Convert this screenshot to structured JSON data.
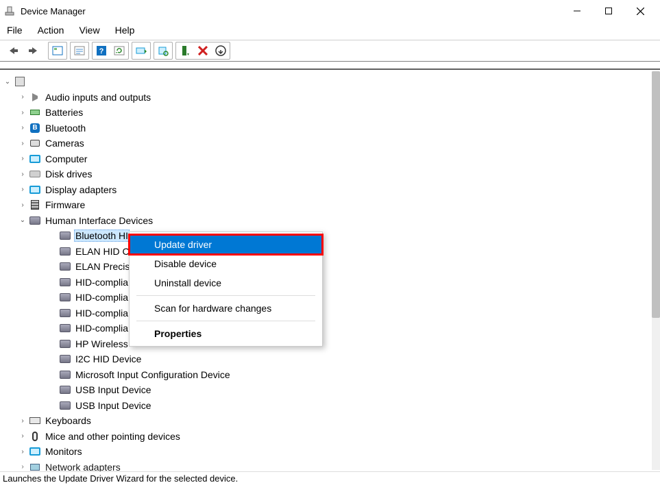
{
  "window": {
    "title": "Device Manager"
  },
  "menubar": [
    "File",
    "Action",
    "View",
    "Help"
  ],
  "toolbar_buttons": [
    "back",
    "forward",
    "sep",
    "show-hidden",
    "sep",
    "properties",
    "sep",
    "help",
    "refresh",
    "sep",
    "update-driver",
    "sep",
    "scan-hardware",
    "sep",
    "enable",
    "disable",
    "uninstall"
  ],
  "root": {
    "expanded": true
  },
  "tree": [
    {
      "icon": "speaker",
      "label": "Audio inputs and outputs",
      "expandable": true
    },
    {
      "icon": "battery",
      "label": "Batteries",
      "expandable": true
    },
    {
      "icon": "bluetooth",
      "label": "Bluetooth",
      "expandable": true
    },
    {
      "icon": "camera",
      "label": "Cameras",
      "expandable": true
    },
    {
      "icon": "monitor",
      "label": "Computer",
      "expandable": true
    },
    {
      "icon": "drive",
      "label": "Disk drives",
      "expandable": true
    },
    {
      "icon": "monitor",
      "label": "Display adapters",
      "expandable": true
    },
    {
      "icon": "firmware",
      "label": "Firmware",
      "expandable": true
    },
    {
      "icon": "hid",
      "label": "Human Interface Devices",
      "expandable": true,
      "expanded": true,
      "children": [
        {
          "label": "Bluetooth HID Device",
          "selected": true,
          "truncated": "Bluetooth HI"
        },
        {
          "label": "ELAN HID Cl",
          "truncated": "ELAN HID Cl"
        },
        {
          "label": "ELAN Precisi",
          "truncated": "ELAN Precisi"
        },
        {
          "label": "HID-complia",
          "truncated": "HID-complia"
        },
        {
          "label": "HID-complia",
          "truncated": "HID-complia"
        },
        {
          "label": "HID-complia",
          "truncated": "HID-complia"
        },
        {
          "label": "HID-complia",
          "truncated": "HID-complia"
        },
        {
          "label": "HP Wireless ",
          "truncated": "HP Wireless "
        },
        {
          "label": "I2C HID Device"
        },
        {
          "label": "Microsoft Input Configuration Device"
        },
        {
          "label": "USB Input Device"
        },
        {
          "label": "USB Input Device"
        }
      ]
    },
    {
      "icon": "keyboard",
      "label": "Keyboards",
      "expandable": true
    },
    {
      "icon": "mouse",
      "label": "Mice and other pointing devices",
      "expandable": true
    },
    {
      "icon": "monitor",
      "label": "Monitors",
      "expandable": true
    },
    {
      "icon": "net",
      "label": "Network adapters",
      "expandable": true,
      "cutoff": true
    }
  ],
  "context_menu": {
    "items": [
      {
        "label": "Update driver",
        "highlighted": true
      },
      {
        "label": "Disable device"
      },
      {
        "label": "Uninstall device"
      },
      {
        "type": "sep"
      },
      {
        "label": "Scan for hardware changes"
      },
      {
        "type": "sep"
      },
      {
        "label": "Properties",
        "bold": true
      }
    ]
  },
  "statusbar": {
    "text": "Launches the Update Driver Wizard for the selected device."
  }
}
